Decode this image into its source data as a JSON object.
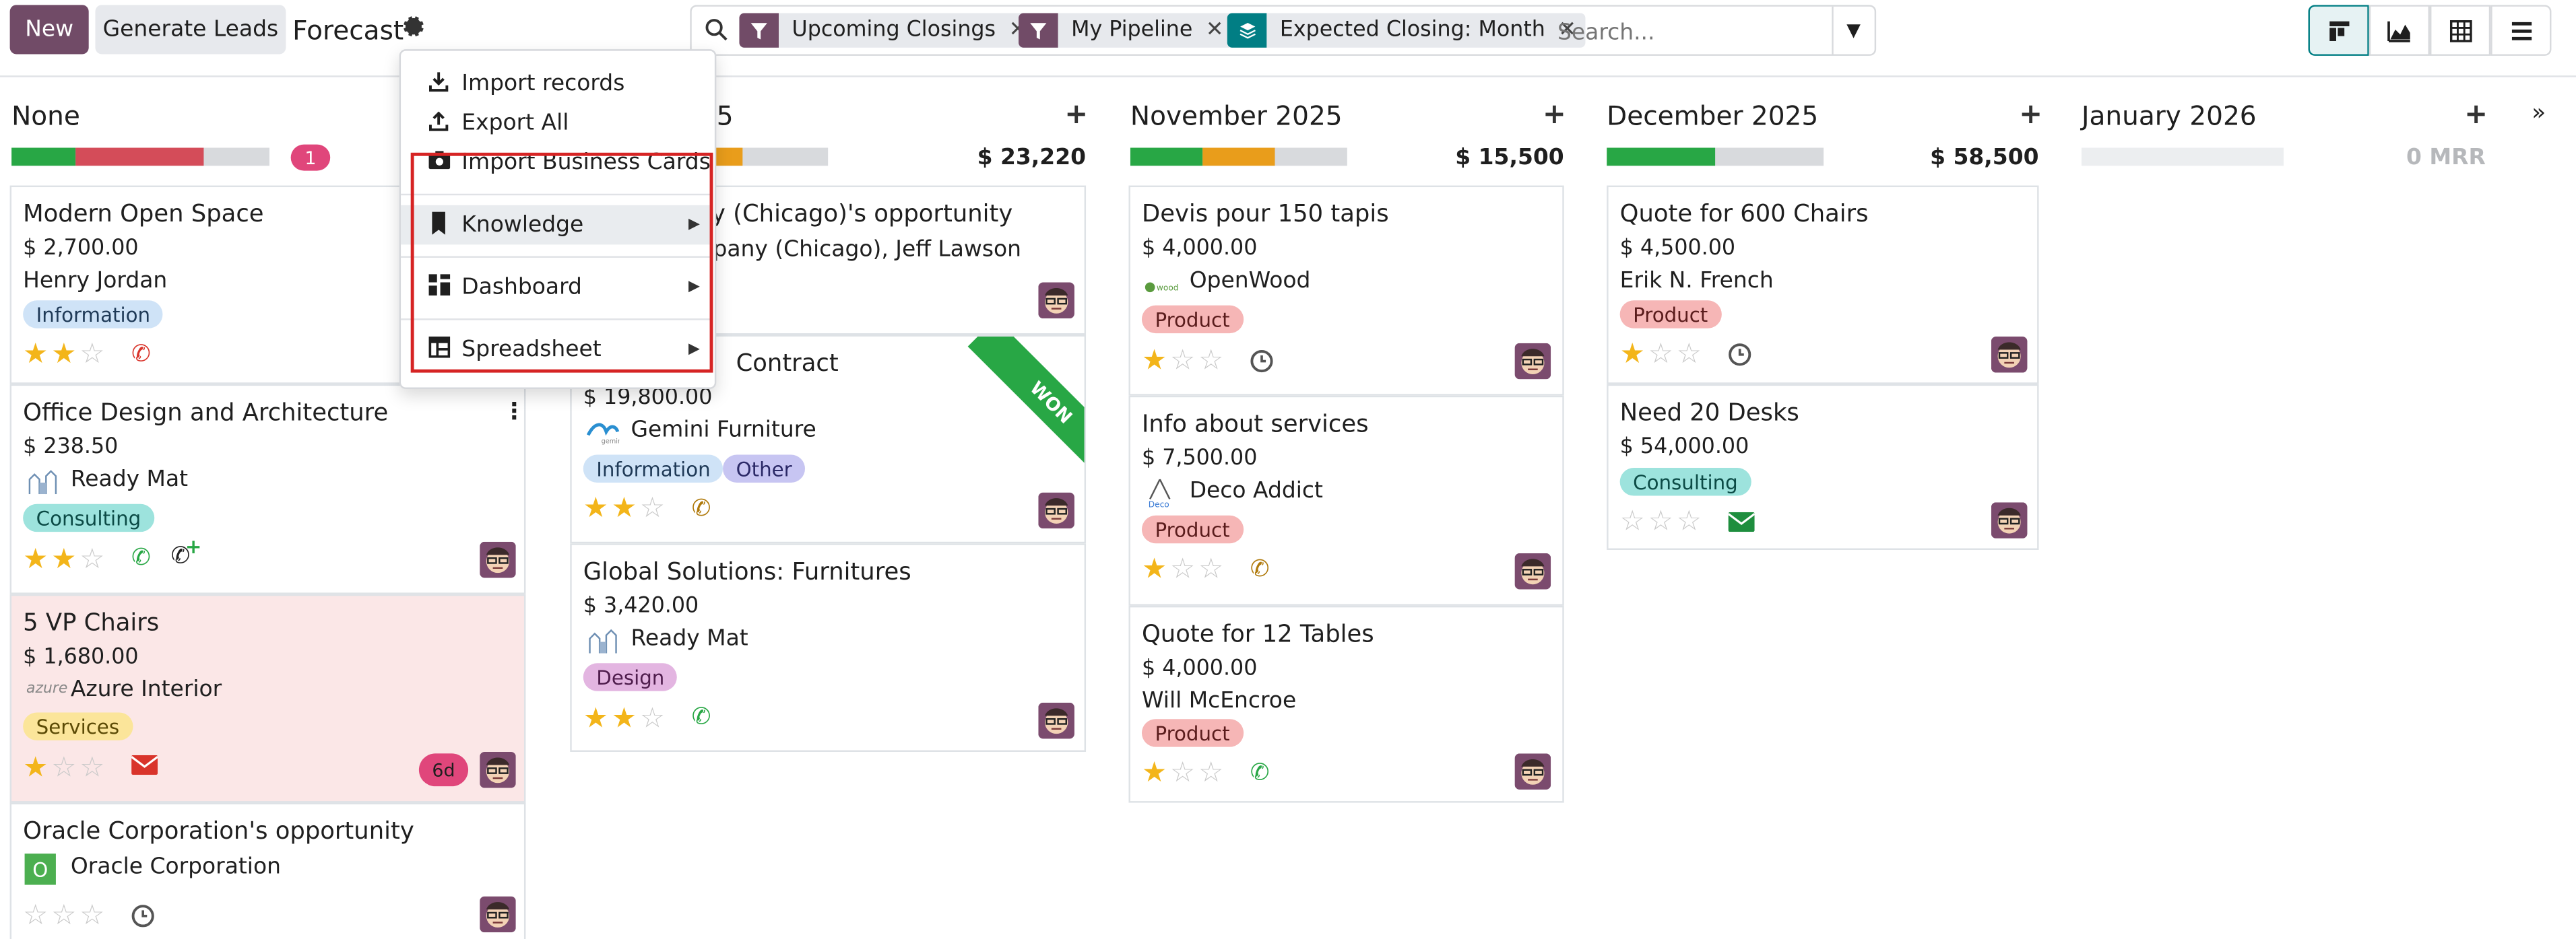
{
  "toolbar": {
    "new_label": "New",
    "generate_leads_label": "Generate Leads",
    "title": "Forecast",
    "settings_icon": "gear-icon"
  },
  "search": {
    "placeholder": "Search...",
    "facets": [
      {
        "label": "Upcoming Closings",
        "icon": "filter-icon",
        "color": "#714b67"
      },
      {
        "label": "My Pipeline",
        "icon": "filter-icon",
        "color": "#714b67"
      },
      {
        "label": "Expected Closing: Month",
        "icon": "layers-icon",
        "color": "#017e84"
      }
    ]
  },
  "views": [
    "kanban-icon",
    "graph-icon",
    "pivot-icon",
    "list-icon"
  ],
  "dropdown": {
    "items": [
      {
        "label": "Import records",
        "icon": "download-icon"
      },
      {
        "label": "Export All",
        "icon": "upload-icon"
      },
      {
        "label": "Import Business Cards",
        "icon": "camera-icon"
      },
      {
        "label": "Knowledge",
        "icon": "bookmark-icon"
      },
      {
        "label": "Dashboard",
        "icon": "dashboard-icon"
      },
      {
        "label": "Spreadsheet",
        "icon": "spreadsheet-icon"
      }
    ]
  },
  "columns": [
    {
      "title": "None",
      "count_badge": "1",
      "progress": {
        "green": 0.25,
        "red": 0.5,
        "orange": 0
      },
      "cards": [
        {
          "title": "Modern Open Space",
          "amount": "$ 2,700.00",
          "partner": "Henry Jordan",
          "tags": [
            "Information"
          ],
          "stars": 2,
          "activity": "phone"
        },
        {
          "title": "Office Design and Architecture",
          "amount": "$ 238.50",
          "partner": "Ready Mat",
          "tags": [
            "Consulting"
          ],
          "stars": 2,
          "activity": "phone"
        },
        {
          "title": "5 VP Chairs",
          "amount": "$ 1,680.00",
          "partner": "Azure Interior",
          "tags": [
            "Services"
          ],
          "stars": 1,
          "activity": "mail",
          "overdue": "6d"
        },
        {
          "title": "Oracle Corporation's opportunity",
          "amount": "",
          "partner": "Oracle Corporation",
          "partner_initial": "O",
          "tags": [],
          "stars": 0,
          "activity": "clock"
        }
      ]
    },
    {
      "title": "25",
      "total": "$ 23,220",
      "progress": {
        "green": 0.6,
        "red": 0,
        "orange": 0.12
      },
      "cards": [
        {
          "title": "y (Chicago)'s opportunity",
          "amount": "",
          "partner": "pany (Chicago), Jeff Lawson",
          "tags": [],
          "stars": 0,
          "activity": ""
        },
        {
          "title": "Contract",
          "amount": "$ 19,800.00",
          "partner": "Gemini Furniture",
          "tags": [
            "Information",
            "Other"
          ],
          "stars": 2,
          "activity": "phone",
          "ribbon": "WON"
        },
        {
          "title": "Global Solutions: Furnitures",
          "amount": "$ 3,420.00",
          "partner": "Ready Mat",
          "tags": [
            "Design"
          ],
          "stars": 2,
          "activity": "phone"
        }
      ]
    },
    {
      "title": "November 2025",
      "total": "$ 15,500",
      "progress": {
        "green": 0.33,
        "red": 0,
        "orange": 0.34
      },
      "cards": [
        {
          "title": "Devis pour 150 tapis",
          "amount": "$ 4,000.00",
          "partner": "OpenWood",
          "tags": [
            "Product"
          ],
          "stars": 1,
          "activity": "clock"
        },
        {
          "title": "Info about services",
          "amount": "$ 7,500.00",
          "partner": "Deco Addict",
          "tags": [
            "Product"
          ],
          "stars": 1,
          "activity": "phone"
        },
        {
          "title": "Quote for 12 Tables",
          "amount": "$ 4,000.00",
          "partner": "Will McEncroe",
          "tags": [
            "Product"
          ],
          "stars": 1,
          "activity": "phone"
        }
      ]
    },
    {
      "title": "December 2025",
      "total": "$ 58,500",
      "progress": {
        "green": 0.5,
        "red": 0,
        "orange": 0
      },
      "cards": [
        {
          "title": "Quote for 600 Chairs",
          "amount": "$ 4,500.00",
          "partner": "Erik N. French",
          "tags": [
            "Product"
          ],
          "stars": 1,
          "activity": "clock"
        },
        {
          "title": "Need 20 Desks",
          "amount": "$ 54,000.00",
          "partner": "",
          "tags": [
            "Consulting"
          ],
          "stars": 0,
          "activity": "mail"
        }
      ]
    },
    {
      "title": "January 2026",
      "total": "0 MRR",
      "progress": {
        "green": 0,
        "red": 0,
        "orange": 0
      },
      "cards": []
    }
  ],
  "colors": {
    "primary": "#714b67",
    "teal": "#017e84",
    "green": "#28a745",
    "red": "#d44c59",
    "orange": "#e99d1b",
    "won_ribbon": "#28a745"
  }
}
